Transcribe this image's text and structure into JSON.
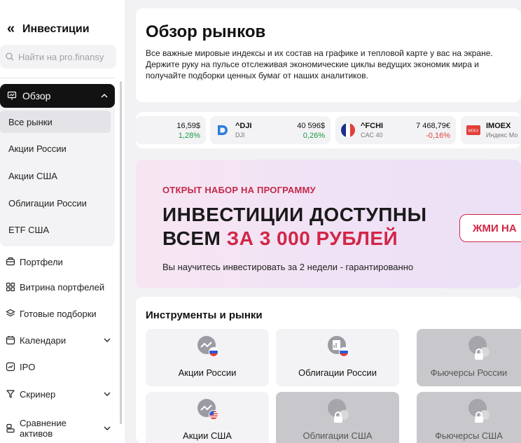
{
  "sidebar": {
    "back_glyph": "«",
    "title": "Инвестиции",
    "search_placeholder": "Найти на pro.finansy",
    "group": {
      "label": "Обзор",
      "items": [
        "Все рынки",
        "Акции России",
        "Акции США",
        "Облигации России",
        "ETF США"
      ]
    },
    "nav": [
      {
        "label": "Портфели",
        "icon": "wallet-icon"
      },
      {
        "label": "Витрина портфелей",
        "icon": "grid-icon"
      },
      {
        "label": "Готовые подборки",
        "icon": "layers-icon"
      },
      {
        "label": "Календари",
        "icon": "calendar-icon"
      },
      {
        "label": "IPO",
        "icon": "chart-line-icon"
      },
      {
        "label": "Скринер",
        "icon": "filter-icon"
      },
      {
        "label": "Сравнение активов",
        "icon": "compare-icon"
      }
    ]
  },
  "overview": {
    "title": "Обзор рынков",
    "description": "Все важные мировые индексы и их состав на графике и тепловой карте у вас на экране. Держите руку на пульсе отслеживая экономические циклы ведущих экономик мира и получайте подборки ценных бумаг от наших аналитиков."
  },
  "ticker": [
    {
      "symbol": "",
      "name": "",
      "price": "16,59$",
      "change": "1,28%",
      "direction": "up",
      "logo": "none"
    },
    {
      "symbol": "^DJI",
      "name": "DJI",
      "price": "40 596$",
      "change": "0,26%",
      "direction": "up",
      "logo": "dji-logo"
    },
    {
      "symbol": "^FCHI",
      "name": "CAC 40",
      "price": "7 468,79€",
      "change": "-0,16%",
      "direction": "down",
      "logo": "france-flag"
    },
    {
      "symbol": "IMOEX",
      "name": "Индекс Мо",
      "price": "",
      "change": "",
      "direction": "",
      "logo": "moex-logo"
    }
  ],
  "promo": {
    "kicker": "ОТКРЫТ НАБОР НА ПРОГРАММУ",
    "headline_line1": "ИНВЕСТИЦИИ ДОСТУПНЫ",
    "headline_line2_start": "ВСЕМ ",
    "headline_line2_accent": "ЗА 3 000 РУБЛЕЙ",
    "note": "Вы научитесь инвестировать за 2 недели - гарантированно",
    "cta": "ЖМИ НА"
  },
  "instruments": {
    "title": "Инструменты и рынки",
    "tiles": [
      {
        "label": "Акции России",
        "locked": false,
        "flag": "ru"
      },
      {
        "label": "Облигации России",
        "locked": false,
        "flag": "ru"
      },
      {
        "label": "Фьючерсы России",
        "locked": true,
        "flag": "ru"
      },
      {
        "label": "Акции США",
        "locked": false,
        "flag": "us"
      },
      {
        "label": "Облигации США",
        "locked": true,
        "flag": "us"
      },
      {
        "label": "Фьючерсы США",
        "locked": true,
        "flag": "us"
      }
    ]
  },
  "colors": {
    "accent_red": "#d22647",
    "up_green": "#1c9b43",
    "down_red": "#e2403a",
    "active_nav": "#121212"
  }
}
